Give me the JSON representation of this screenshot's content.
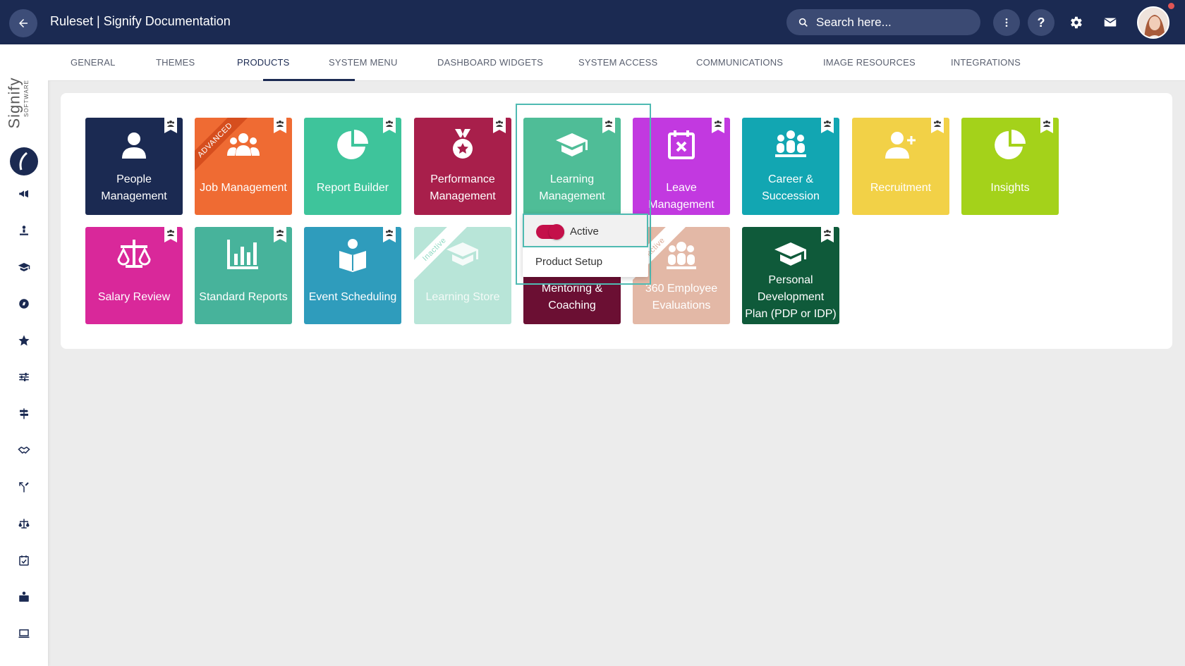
{
  "header": {
    "back_icon": "arrow-left-icon",
    "title": "Ruleset | Signify Documentation",
    "search_placeholder": "Search here...",
    "icons": [
      "more-vertical-icon",
      "help-icon",
      "gear-icon",
      "mail-icon",
      "avatar"
    ]
  },
  "brand": {
    "name": "Signify",
    "sub": "SOFTWARE"
  },
  "sidebar": {
    "icons": [
      "megaphone-icon",
      "person-pin-icon",
      "graduation-cap-icon",
      "compass-icon",
      "star-icon",
      "sliders-icon",
      "signpost-icon",
      "handshake-icon",
      "fork-arrow-icon",
      "scales-icon",
      "calendar-check-icon",
      "briefcase-icon",
      "laptop-icon"
    ]
  },
  "tabs": [
    {
      "label": "GENERAL"
    },
    {
      "label": "THEMES"
    },
    {
      "label": "PRODUCTS",
      "active": true
    },
    {
      "label": "SYSTEM MENU"
    },
    {
      "label": "DASHBOARD WIDGETS"
    },
    {
      "label": "SYSTEM ACCESS"
    },
    {
      "label": "COMMUNICATIONS"
    },
    {
      "label": "IMAGE RESOURCES"
    },
    {
      "label": "INTEGRATIONS"
    }
  ],
  "products": {
    "row1": [
      {
        "label": "People Management",
        "color": "#1b2a52",
        "icon": "person-icon"
      },
      {
        "label": "Job Management",
        "color": "#ef6b33",
        "icon": "group-icon",
        "ribbon": "ADVANCED"
      },
      {
        "label": "Report Builder",
        "color": "#3ec49b",
        "icon": "pie-chart-icon"
      },
      {
        "label": "Performance Management",
        "color": "#a81f4b",
        "icon": "medal-icon"
      },
      {
        "label": "Learning Management",
        "color": "#4fbd97",
        "icon": "graduation-cap-icon"
      },
      {
        "label": "Leave Management",
        "color": "#c239e0",
        "icon": "calendar-x-icon"
      },
      {
        "label": "Career & Succession",
        "color": "#12a6b2",
        "icon": "team-icon"
      },
      {
        "label": "Recruitment",
        "color": "#f2d147",
        "icon": "person-add-icon"
      },
      {
        "label": "Insights",
        "color": "#a4d21a",
        "icon": "pie-chart-icon"
      }
    ],
    "row2": [
      {
        "label": "Salary Review",
        "color": "#d9289a",
        "icon": "scales-icon"
      },
      {
        "label": "Standard Reports",
        "color": "#47b39b",
        "icon": "bar-chart-icon"
      },
      {
        "label": "Event Scheduling",
        "color": "#2f9cbc",
        "icon": "reader-icon"
      },
      {
        "label": "Learning Store",
        "color": "#8fd9c3",
        "icon": "graduation-cap-icon",
        "ribbon": "Inactive"
      },
      {
        "label": "Mentoring & Coaching",
        "color": "#6b0f33",
        "icon": "handshake-icon"
      },
      {
        "label": "360 Employee Evaluations",
        "color": "#d9a894",
        "icon": "group-icon",
        "ribbon": "Inactive"
      },
      {
        "label": "Personal Development Plan (PDP or IDP)",
        "color": "#0f5a3a",
        "icon": "graduation-cap-icon"
      }
    ]
  },
  "context_menu": {
    "toggle_label": "Active",
    "toggle_on": true,
    "setup_label": "Product Setup"
  }
}
